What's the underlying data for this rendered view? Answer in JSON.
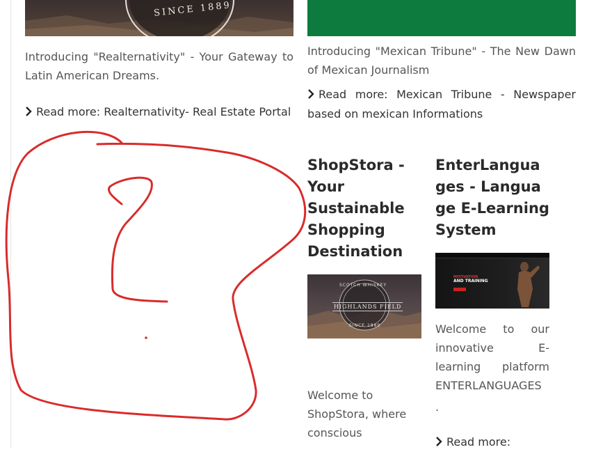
{
  "col1": {
    "seal_text": "SINCE 1889",
    "intro": "Introducing \"Realternativity\" - Your Gateway to Latin American Dreams.",
    "read_more": "Read more: Realternativity- Real Estate Portal"
  },
  "col2": {
    "intro": "Introducing \"Mexican Tribune\" - The New Dawn of Mexican Journalism",
    "read_more": "Read more: Mexican Tribune - Newspaper based on mexican Informations"
  },
  "shopstora": {
    "title": "ShopStora - Your Sustainable Shopping Destination",
    "thumb_top": "SCOTCH WHISKEY",
    "thumb_mid": "HIGHLANDS FIELD",
    "thumb_bottom": "SINCE 1889",
    "intro": "Welcome to ShopStora, where conscious"
  },
  "enterlanguages": {
    "title": "EnterLanguages - Language E-Learning System",
    "thumb_line1": "MOTIVATION",
    "thumb_line2": "AND TRAINING",
    "intro": "Welcome to our innovative E-learning platform ENTERLANGUAGES",
    "period": ".",
    "read_more": "Read more:"
  },
  "colors": {
    "scribble": "#d92b2b",
    "mexican_green": "#0d7a3e"
  }
}
